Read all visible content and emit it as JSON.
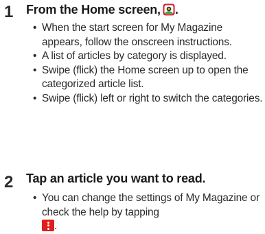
{
  "steps": [
    {
      "number": "1",
      "heading_before_icon": "From the Home screen,",
      "heading_after_icon": ".",
      "icon": "my-magazine-app-icon",
      "bullets": [
        "When the start screen for My Magazine appears, follow the onscreen instructions.",
        "A list of articles by category is displayed.",
        "Swipe (flick) the Home screen up to open the categorized article list.",
        "Swipe (flick) left or right to switch the categories."
      ]
    },
    {
      "number": "2",
      "heading": "Tap an article you want to read.",
      "bullets": [
        {
          "text_before_icon": "You can change the settings of My Magazine or check the help by tapping",
          "icon": "more-options-icon",
          "text_after_icon": "."
        }
      ]
    }
  ],
  "bullet_char": "•",
  "colors": {
    "text": "#2a2a2a",
    "menu_icon_bg": "#e11d1d"
  }
}
